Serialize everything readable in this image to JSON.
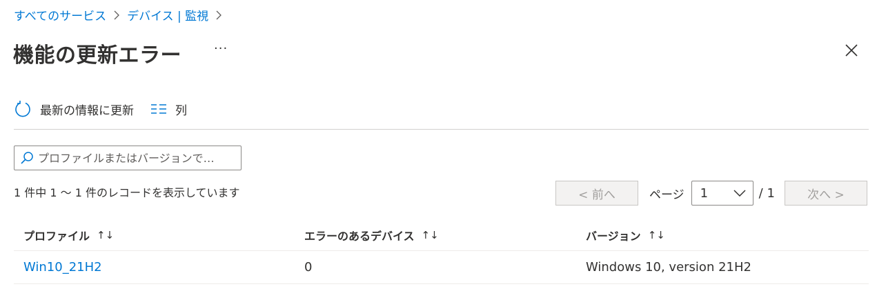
{
  "breadcrumb": {
    "items": [
      "すべてのサービス",
      "デバイス | 監視"
    ]
  },
  "page": {
    "title": "機能の更新エラー",
    "more_label": "···"
  },
  "toolbar": {
    "refresh_label": "最新の情報に更新",
    "columns_label": "列"
  },
  "search": {
    "placeholder": "プロファイルまたはバージョンで…",
    "value": ""
  },
  "records": {
    "summary": "1 件中 1 〜 1 件のレコードを表示しています"
  },
  "pager": {
    "prev_label": "< 前へ",
    "page_label": "ページ",
    "current_page": "1",
    "total": "/ 1",
    "next_label": "次へ >"
  },
  "table": {
    "headers": [
      "プロファイル",
      "エラーのあるデバイス",
      "バージョン"
    ],
    "sort_glyph": "↑↓",
    "rows": [
      [
        "Win10_21H2",
        "0",
        "Windows 10, version 21H2"
      ]
    ]
  },
  "colors": {
    "accent": "#0078d4",
    "text": "#323130",
    "disabled": "#a19f9d"
  }
}
